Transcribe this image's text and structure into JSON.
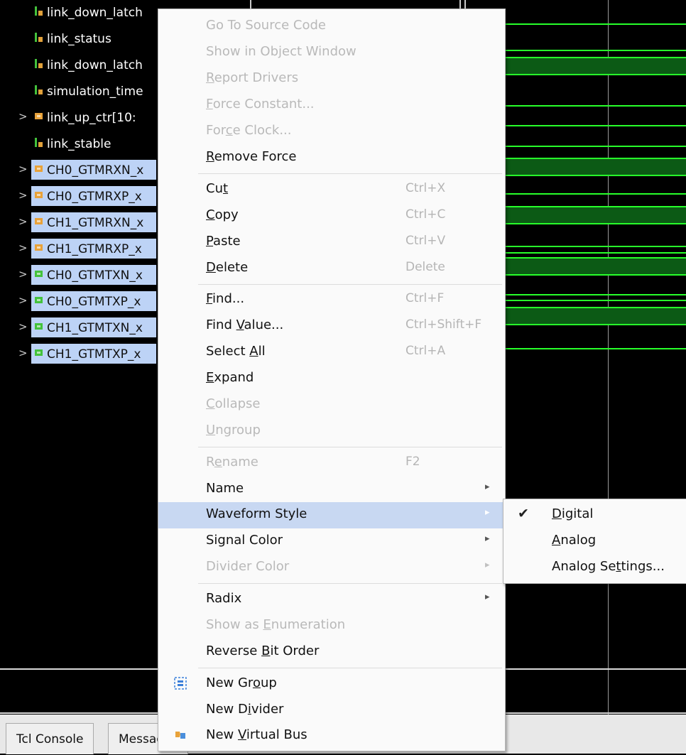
{
  "signals": [
    {
      "name": "link_down_latch",
      "kind": "bit",
      "expandable": false,
      "selected": false
    },
    {
      "name": "link_status",
      "kind": "bit",
      "expandable": false,
      "selected": false
    },
    {
      "name": "link_down_latch",
      "kind": "bit",
      "expandable": false,
      "selected": false
    },
    {
      "name": "simulation_time",
      "kind": "bit",
      "expandable": false,
      "selected": false
    },
    {
      "name": "link_up_ctr[10:",
      "kind": "bus",
      "expandable": true,
      "selected": false
    },
    {
      "name": "link_stable",
      "kind": "bit",
      "expandable": false,
      "selected": false
    },
    {
      "name": "CH0_GTMRXN_x",
      "kind": "in-bus",
      "expandable": true,
      "selected": true
    },
    {
      "name": "CH0_GTMRXP_x",
      "kind": "in-bus",
      "expandable": true,
      "selected": true
    },
    {
      "name": "CH1_GTMRXN_x",
      "kind": "in-bus",
      "expandable": true,
      "selected": true
    },
    {
      "name": "CH1_GTMRXP_x",
      "kind": "in-bus",
      "expandable": true,
      "selected": true
    },
    {
      "name": "CH0_GTMTXN_x",
      "kind": "out-bus",
      "expandable": true,
      "selected": true
    },
    {
      "name": "CH0_GTMTXP_x",
      "kind": "out-bus",
      "expandable": true,
      "selected": true
    },
    {
      "name": "CH1_GTMTXN_x",
      "kind": "out-bus",
      "expandable": true,
      "selected": true
    },
    {
      "name": "CH1_GTMTXP_x",
      "kind": "out-bus",
      "expandable": true,
      "selected": true
    }
  ],
  "colors": {
    "wave_green": "#27ff2a",
    "bus_fill": "#0c5a15",
    "selection": "#bdd3f6",
    "menu_highlight": "#c8d8f2"
  },
  "bottom_tabs": {
    "tcl_console": "Tcl Console",
    "messages": "Messages"
  },
  "context_menu": {
    "go_to_source": {
      "label": "Go To Source Code",
      "enabled": false
    },
    "show_object_window": {
      "label": "Show in Object Window",
      "enabled": false
    },
    "report_drivers": {
      "pre": "",
      "u": "R",
      "post": "eport Drivers",
      "enabled": false
    },
    "force_constant": {
      "pre": "",
      "u": "F",
      "post": "orce Constant...",
      "enabled": false
    },
    "force_clock": {
      "pre": "For",
      "u": "c",
      "post": "e Clock...",
      "enabled": false
    },
    "remove_force": {
      "pre": "",
      "u": "R",
      "post": "emove Force",
      "enabled": true
    },
    "cut": {
      "pre": "Cu",
      "u": "t",
      "post": "",
      "shortcut": "Ctrl+X"
    },
    "copy": {
      "pre": "",
      "u": "C",
      "post": "opy",
      "shortcut": "Ctrl+C"
    },
    "paste": {
      "pre": "",
      "u": "P",
      "post": "aste",
      "shortcut": "Ctrl+V"
    },
    "delete": {
      "pre": "",
      "u": "D",
      "post": "elete",
      "shortcut": "Delete"
    },
    "find": {
      "pre": "",
      "u": "F",
      "post": "ind...",
      "shortcut": "Ctrl+F"
    },
    "find_value": {
      "pre": "Find ",
      "u": "V",
      "post": "alue...",
      "shortcut": "Ctrl+Shift+F"
    },
    "select_all": {
      "pre": "Select ",
      "u": "A",
      "post": "ll",
      "shortcut": "Ctrl+A"
    },
    "expand": {
      "pre": "",
      "u": "E",
      "post": "xpand"
    },
    "collapse": {
      "pre": "",
      "u": "C",
      "post": "ollapse",
      "enabled": false
    },
    "ungroup": {
      "pre": "",
      "u": "U",
      "post": "ngroup",
      "enabled": false
    },
    "rename": {
      "pre": "R",
      "u": "e",
      "post": "name",
      "shortcut": "F2",
      "enabled": false
    },
    "name": {
      "label": "Name"
    },
    "waveform_style": {
      "label": "Waveform Style"
    },
    "signal_color": {
      "label": "Signal Color"
    },
    "divider_color": {
      "label": "Divider Color",
      "enabled": false
    },
    "radix": {
      "label": "Radix"
    },
    "show_as_enumeration": {
      "pre": "Show as ",
      "u": "E",
      "post": "numeration",
      "enabled": false
    },
    "reverse_bit_order": {
      "pre": "Reverse ",
      "u": "B",
      "post": "it Order"
    },
    "new_group": {
      "pre": "New Gr",
      "u": "o",
      "post": "up",
      "icon": "group-icon"
    },
    "new_divider": {
      "pre": "New D",
      "u": "i",
      "post": "vider"
    },
    "new_virtual_bus": {
      "pre": "New ",
      "u": "V",
      "post": "irtual Bus",
      "icon": "virtual-bus-icon"
    }
  },
  "waveform_style_submenu": {
    "digital": {
      "pre": "",
      "u": "D",
      "post": "igital",
      "checked": true
    },
    "analog": {
      "pre": "",
      "u": "A",
      "post": "nalog",
      "checked": false
    },
    "analog_settings": {
      "pre": "Analog Se",
      "u": "t",
      "post": "tings...",
      "checked": false
    }
  }
}
